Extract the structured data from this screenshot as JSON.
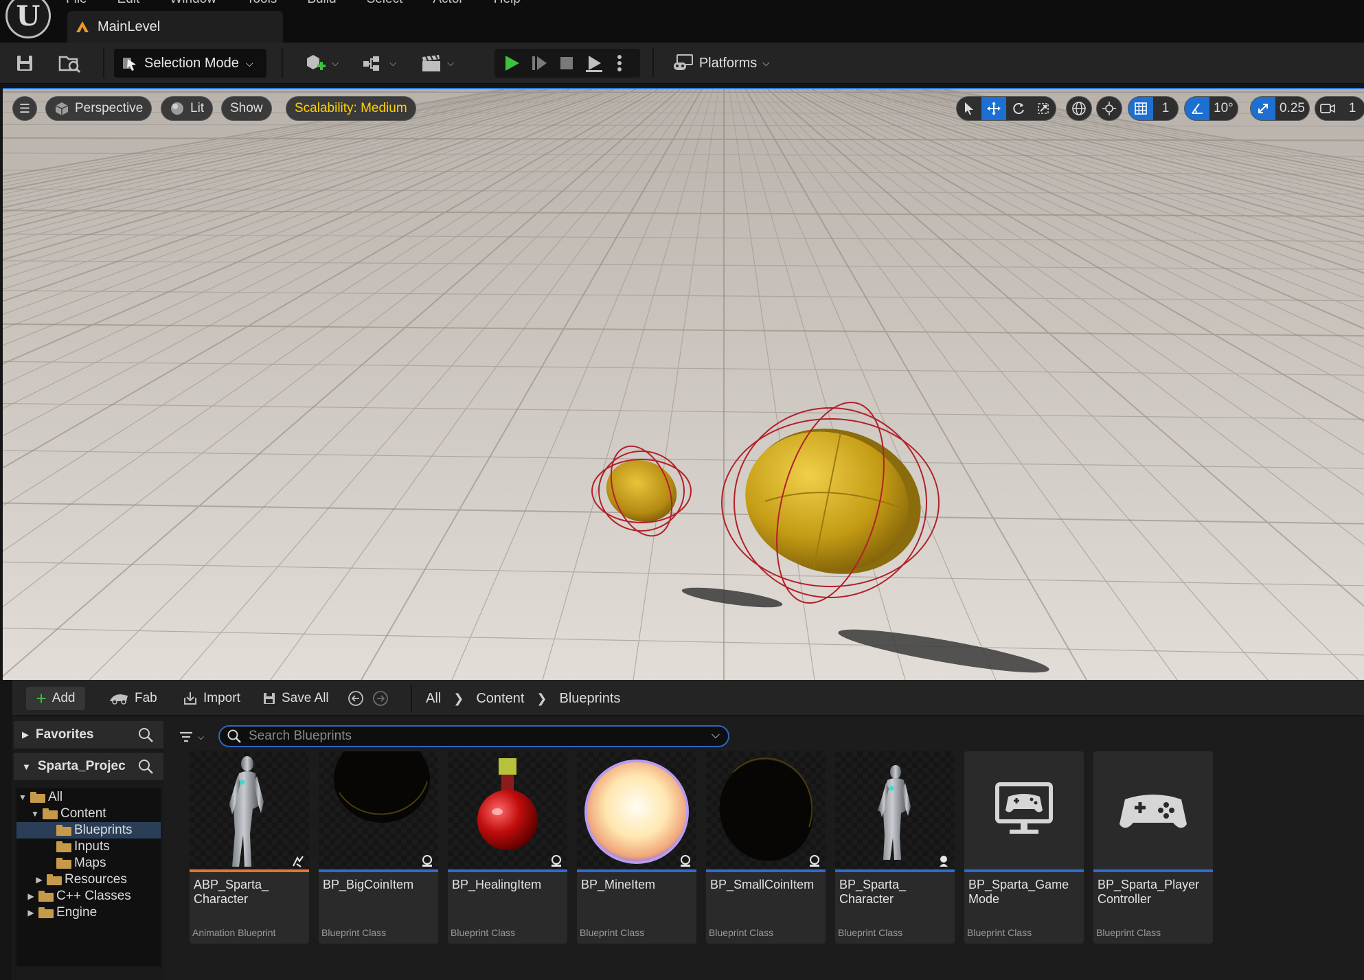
{
  "app": {
    "menu": [
      "File",
      "Edit",
      "Window",
      "Tools",
      "Build",
      "Select",
      "Actor",
      "Help"
    ],
    "level_tab": "MainLevel"
  },
  "toolbar": {
    "selection_mode": "Selection Mode",
    "platforms": "Platforms"
  },
  "viewport": {
    "perspective": "Perspective",
    "lit": "Lit",
    "show": "Show",
    "scalability": "Scalability: Medium",
    "grid_value": "1",
    "rotation_snap": "10°",
    "scale_snap": "0.25",
    "camera_speed": "1",
    "accent": "#1d6fd1",
    "scalability_color": "#ffd200"
  },
  "content_browser": {
    "add": "Add",
    "fab": "Fab",
    "import": "Import",
    "save_all": "Save All",
    "breadcrumb": [
      "All",
      "Content",
      "Blueprints"
    ],
    "favorites": "Favorites",
    "project": "Sparta_Projec",
    "tree": [
      {
        "label": "All"
      },
      {
        "label": "Content"
      },
      {
        "label": "Blueprints"
      },
      {
        "label": "Inputs"
      },
      {
        "label": "Maps"
      },
      {
        "label": "Resources"
      },
      {
        "label": "C++ Classes"
      },
      {
        "label": "Engine"
      }
    ],
    "search_placeholder": "Search Blueprints",
    "assets": [
      {
        "name": "ABP_Sparta_ Character",
        "type": "Animation Blueprint",
        "thumb": "mannequin"
      },
      {
        "name": "BP_BigCoinItem",
        "type": "Blueprint Class",
        "thumb": "dark-coin"
      },
      {
        "name": "BP_HealingItem",
        "type": "Blueprint Class",
        "thumb": "potion"
      },
      {
        "name": "BP_MineItem",
        "type": "Blueprint Class",
        "thumb": "glow-sphere"
      },
      {
        "name": "BP_SmallCoinItem",
        "type": "Blueprint Class",
        "thumb": "dark-coin"
      },
      {
        "name": "BP_Sparta_ Character",
        "type": "Blueprint Class",
        "thumb": "mannequin"
      },
      {
        "name": "BP_Sparta_Game Mode",
        "type": "Blueprint Class",
        "thumb": "monitor-gamepad"
      },
      {
        "name": "BP_Sparta_Player Controller",
        "type": "Blueprint Class",
        "thumb": "gamepad"
      }
    ]
  }
}
